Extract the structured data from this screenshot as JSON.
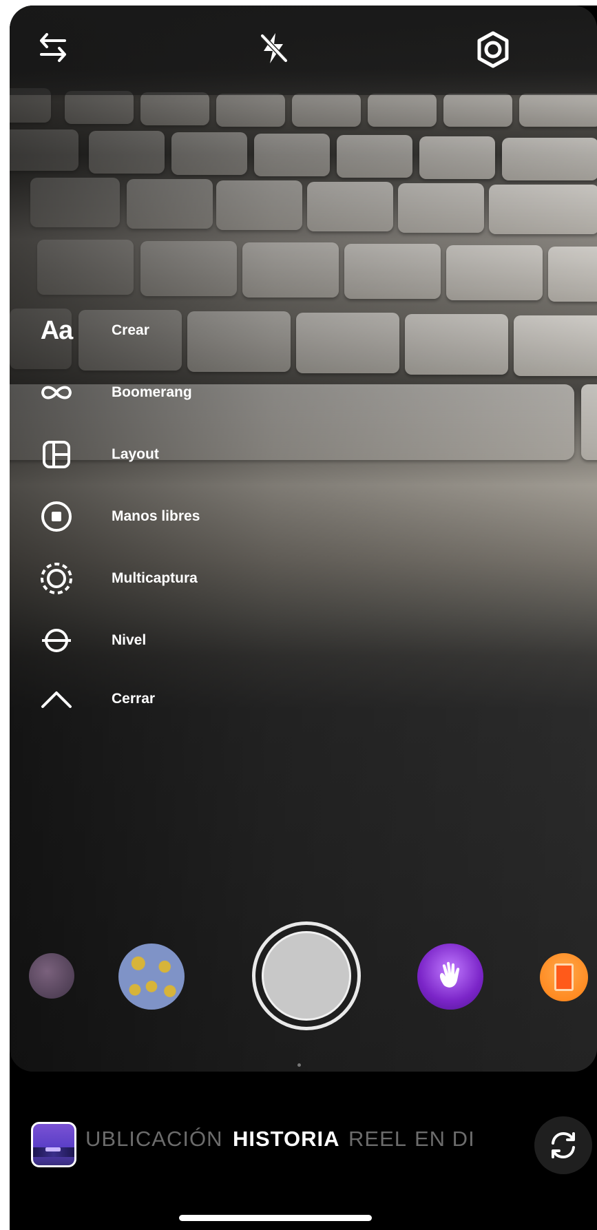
{
  "top_bar": {
    "left_icon": "arrows-swap-icon",
    "center_icon": "flash-off-icon",
    "right_icon": "settings-gear-icon"
  },
  "menu": {
    "items": [
      {
        "icon": "text-aa-icon",
        "glyph": "Aa",
        "label": "Crear"
      },
      {
        "icon": "infinity-icon",
        "label": "Boomerang"
      },
      {
        "icon": "layout-grid-icon",
        "label": "Layout"
      },
      {
        "icon": "hands-free-record-icon",
        "label": "Manos libres"
      },
      {
        "icon": "multi-capture-icon",
        "label": "Multicaptura"
      },
      {
        "icon": "level-icon",
        "label": "Nivel"
      },
      {
        "icon": "chevron-up-icon",
        "label": "Cerrar"
      }
    ]
  },
  "effects": [
    {
      "name": "effect-thumb-1",
      "color": "#6a4f6e"
    },
    {
      "name": "effect-thumb-2",
      "color": "#7f93c7"
    },
    {
      "name": "effect-thumb-3",
      "color": "#8a2fd0"
    },
    {
      "name": "effect-thumb-4",
      "color": "#ff8a1c"
    }
  ],
  "modes": [
    {
      "label": "UBLICACIÓN",
      "active": false
    },
    {
      "label": "HISTORIA",
      "active": true
    },
    {
      "label": "REEL",
      "active": false
    },
    {
      "label": "EN DI",
      "active": false
    }
  ],
  "bottom": {
    "gallery_icon": "gallery-thumbnail-icon",
    "flip_icon": "camera-flip-icon"
  }
}
